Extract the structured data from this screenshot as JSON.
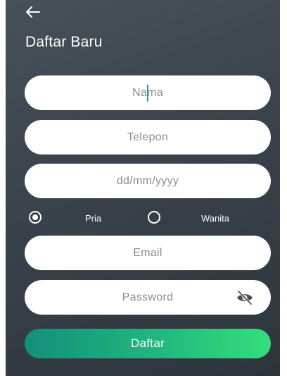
{
  "header": {
    "back_icon": "arrow-left-icon",
    "title": "Daftar Baru"
  },
  "form": {
    "name": {
      "placeholder": "Nama",
      "value": ""
    },
    "phone": {
      "placeholder": "Telepon",
      "value": ""
    },
    "birthdate": {
      "placeholder": "dd/mm/yyyy",
      "value": ""
    },
    "gender": {
      "options": [
        {
          "label": "Pria",
          "selected": true
        },
        {
          "label": "Wanita",
          "selected": false
        }
      ]
    },
    "email": {
      "placeholder": "Email",
      "value": ""
    },
    "password": {
      "placeholder": "Password",
      "value": "",
      "toggle_icon": "eye-slash-icon"
    },
    "submit_label": "Daftar"
  },
  "colors": {
    "background_top": "#48505a",
    "background_bottom": "#2d343c",
    "button_start": "#14907c",
    "button_end": "#34de7c",
    "caret": "#1aa59a"
  }
}
